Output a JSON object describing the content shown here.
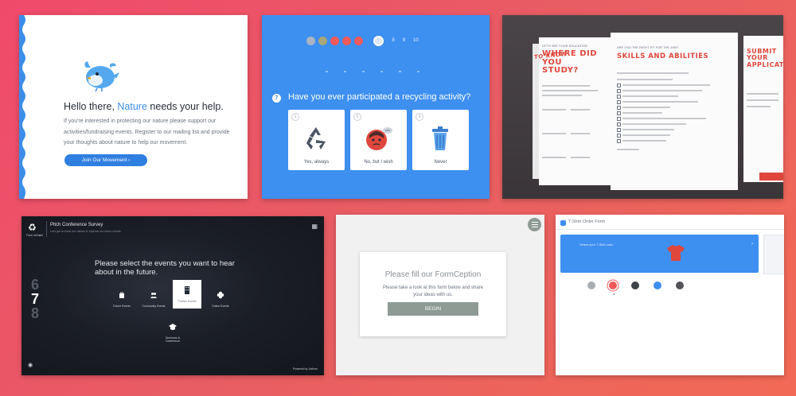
{
  "tile1": {
    "title_prefix": "Hello there, ",
    "title_highlight": "Nature",
    "title_suffix": " needs your help.",
    "body": "If you're interested in protecting our nature please support our activities/fundraising events. Register to our mailing list and provide your thoughts about nature to help our movement.",
    "cta": "Join Our Movement  ›",
    "accent": "#3b8ee8",
    "icon": "bird-mascot-icon"
  },
  "tile2": {
    "progress": [
      {
        "label": "",
        "color": "#aab4c0"
      },
      {
        "label": "",
        "color": "#a9a77a"
      },
      {
        "label": "",
        "color": "#f05a5a"
      },
      {
        "label": "",
        "color": "#f05a5a"
      },
      {
        "label": "",
        "color": "#f05a5a"
      },
      {
        "label": "",
        "color": "current"
      }
    ],
    "progress_nums": [
      "7",
      "8",
      "9",
      "10"
    ],
    "question_number": "7",
    "question": "Have you ever participated a recycling activity?",
    "options": [
      {
        "num": "1",
        "label": "Yes, always",
        "icon": "recycle-icon"
      },
      {
        "num": "2",
        "label": "No, but I wish",
        "icon": "thinking-face-icon"
      },
      {
        "num": "3",
        "label": "Never",
        "icon": "trash-can-icon"
      }
    ],
    "background": "#3d8ff0"
  },
  "tile3": {
    "left_kicker": "LET'S SEE YOUR EDUCATION",
    "left_title": "WHERE DID YOU STUDY?",
    "left_title_partial": "TO KNOW",
    "center_kicker": "ARE YOU THE RIGHT FIT FOR THE JOB?",
    "center_title": "SKILLS AND ABILITIES",
    "right_title": "SUBMIT YOUR APPLICATION",
    "accent": "#e0473c"
  },
  "tile4": {
    "logo_sub": "Form inGuide",
    "survey_title": "Pitch Conference Survey",
    "survey_sub": "Let's get to know our visitors to improve our future events",
    "counter": [
      "6",
      "7",
      "8"
    ],
    "prompt": "Please select the events you want to hear about in the future.",
    "options": [
      {
        "label": "Future Events",
        "icon": "bag-icon",
        "selected": false
      },
      {
        "label": "Community Events",
        "icon": "people-icon",
        "selected": false
      },
      {
        "label": "Partner Events",
        "icon": "building-icon",
        "selected": true
      },
      {
        "label": "Online Events",
        "icon": "clover-icon",
        "selected": false
      },
      {
        "label": "Seminars & Conference",
        "icon": "graduation-cap-icon",
        "selected": false
      }
    ],
    "powered_by": "Powered by Jotform"
  },
  "tile5": {
    "title": "Please fill our FormCeption",
    "body": "Please take a look at this form below and share your ideas with us.",
    "button": "BEGIN"
  },
  "tile6": {
    "header": "T-Shirt Order Form",
    "panel_label": "Select your T-Shirt color",
    "swatches": [
      "#a9aeb4",
      "#f05a5a",
      "#3f4249",
      "#3d8ff0",
      "#55525a"
    ],
    "shirt_color": "#e0473c"
  }
}
